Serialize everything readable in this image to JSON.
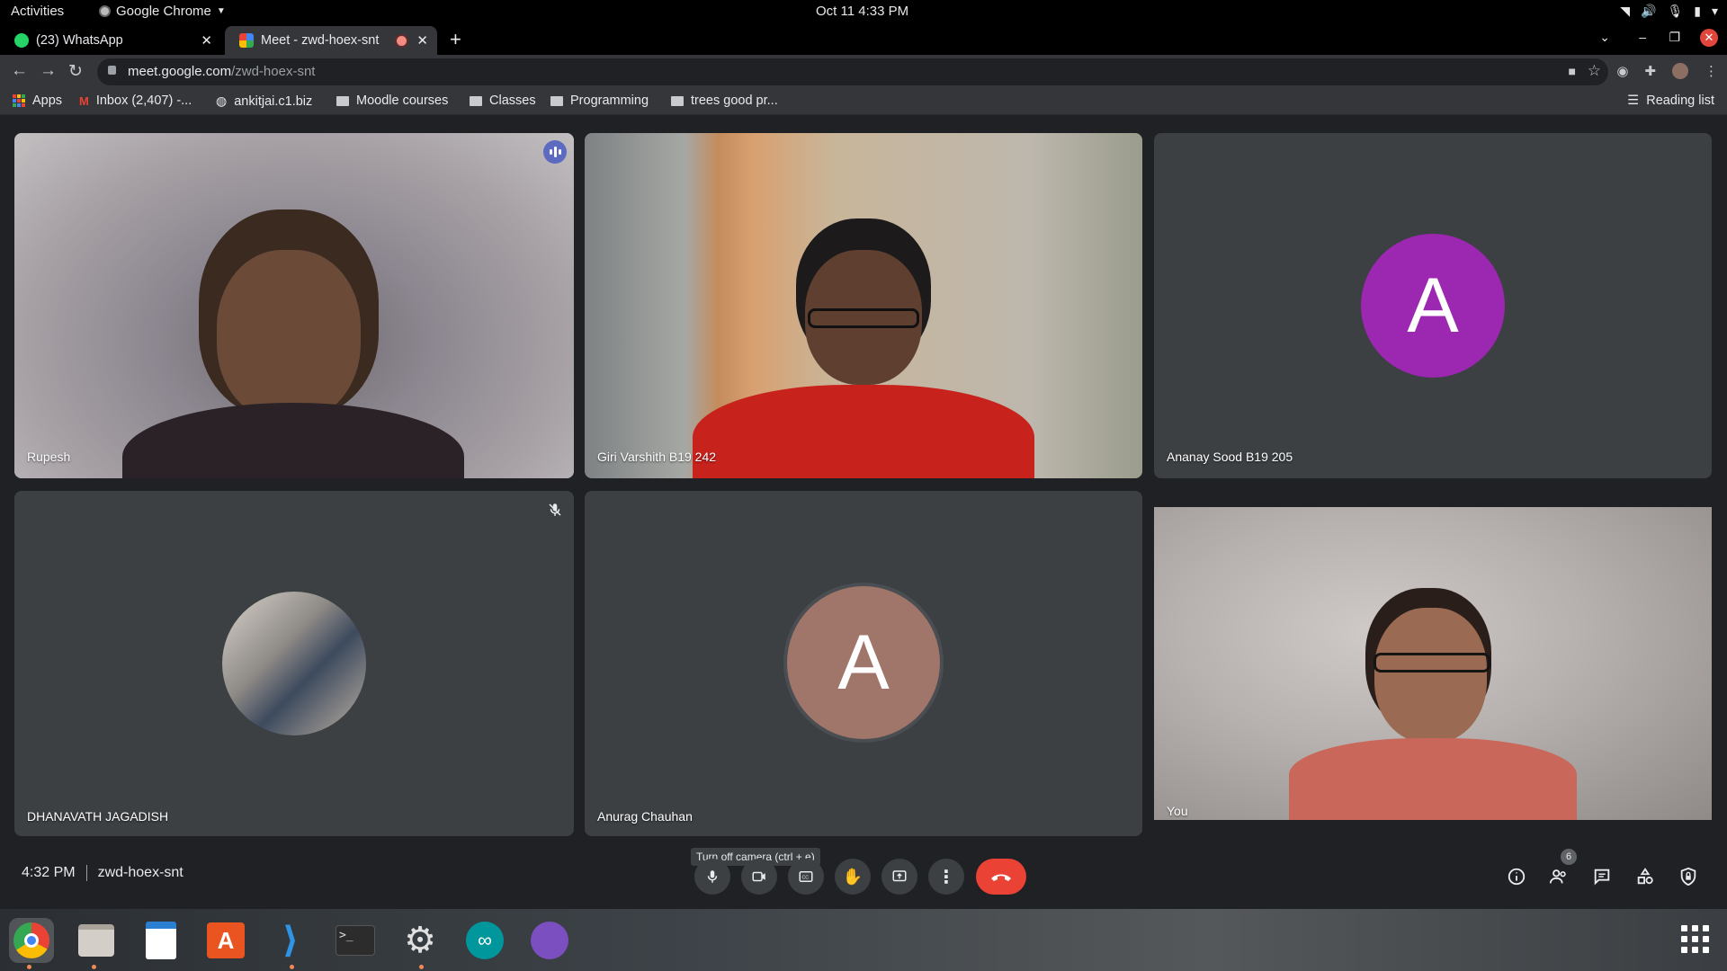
{
  "system": {
    "activities": "Activities",
    "app_name": "Google Chrome",
    "clock": "Oct 11  4:33 PM"
  },
  "tabs": [
    {
      "title": "(23) WhatsApp",
      "favicon": "whatsapp-icon",
      "active": false
    },
    {
      "title": "Meet - zwd-hoex-snt",
      "favicon": "google-meet-icon",
      "active": true,
      "recording": true
    }
  ],
  "address_bar": {
    "host": "meet.google.com",
    "path": "/zwd-hoex-snt"
  },
  "bookmarks": [
    {
      "label": "Apps",
      "icon": "apps-grid-icon"
    },
    {
      "label": "Inbox (2,407) -...",
      "icon": "gmail-icon"
    },
    {
      "label": "ankitjai.c1.biz",
      "icon": "globe-icon"
    },
    {
      "label": "Moodle courses",
      "icon": "folder-icon"
    },
    {
      "label": "Classes",
      "icon": "folder-icon"
    },
    {
      "label": "Programming",
      "icon": "folder-icon"
    },
    {
      "label": "trees good pr...",
      "icon": "folder-icon"
    }
  ],
  "reading_list": "Reading list",
  "participants": [
    {
      "name": "Rupesh",
      "type": "video",
      "speaking": true
    },
    {
      "name": "Giri Varshith B19 242",
      "type": "video"
    },
    {
      "name": "Ananay Sood B19 205",
      "type": "avatar",
      "initial": "A",
      "color": "#9c27b0"
    },
    {
      "name": "DHANAVATH JAGADISH",
      "type": "photo",
      "muted": true
    },
    {
      "name": "Anurag Chauhan",
      "type": "avatar",
      "initial": "A",
      "color": "#a1766a"
    },
    {
      "name": "You",
      "type": "video"
    }
  ],
  "controls": {
    "time": "4:32 PM",
    "meeting_code": "zwd-hoex-snt",
    "tooltip": "Turn off camera (ctrl + e)",
    "people_count": "6"
  },
  "colors": {
    "speaking_outline": "#8ab4f8",
    "end_call": "#ea4335",
    "tile_bg": "#3c4043"
  }
}
